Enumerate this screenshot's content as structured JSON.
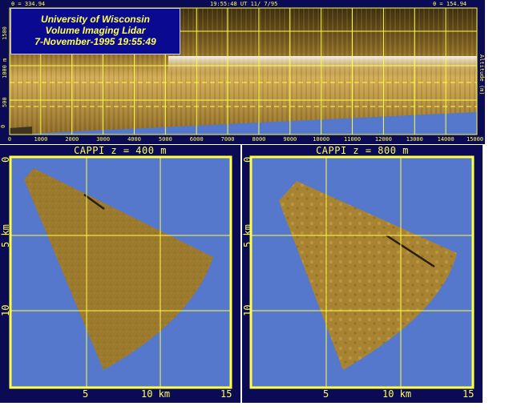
{
  "rhi": {
    "title_lines": [
      "University of Wisconsin",
      "Volume Imaging Lidar",
      "7-November-1995 19:55:49"
    ],
    "theta_left": "θ = 334.94",
    "timestamp": "19:55:48 UT 11/ 7/95",
    "theta_right": "θ = 154.94",
    "y_ticks": [
      "0",
      "500",
      "1000 m",
      "1500"
    ],
    "x_ticks": [
      "0",
      "1000",
      "2000",
      "3000",
      "4000",
      "5000",
      "6000",
      "7000",
      "8000",
      "9000",
      "10000",
      "11000",
      "12000",
      "13000",
      "14000",
      "15000"
    ],
    "right_label": "Altitude (m)"
  },
  "cappi_left": {
    "title": "CAPPI  z = 400 m",
    "y_ticks": [
      "0",
      "5 km",
      "10"
    ],
    "x_ticks": [
      "5",
      "10 km",
      "15"
    ]
  },
  "cappi_right": {
    "title": "CAPPI  z = 800 m",
    "y_ticks": [
      "0",
      "5 km",
      "10"
    ],
    "x_ticks": [
      "5",
      "10 km",
      "15"
    ]
  },
  "colors": {
    "frame": "#0b0b55",
    "grid": "#ffff44",
    "sky": "#5577cc",
    "aerosol": "#a07a2a"
  }
}
